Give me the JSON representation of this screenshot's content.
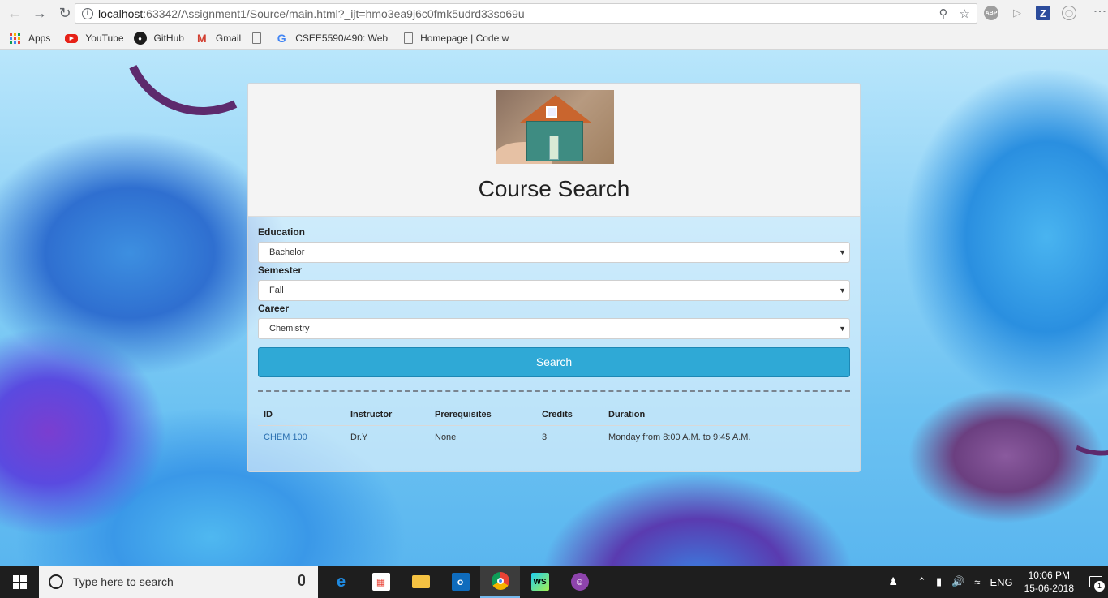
{
  "browser": {
    "url_host": "localhost",
    "url_rest": ":63342/Assignment1/Source/main.html?_ijt=hmo3ea9j6c0fmk5udrd33so69u",
    "extensions": [
      "ABP",
      "Z"
    ]
  },
  "bookmarks": [
    {
      "label": "Apps",
      "icon": "apps-grid-icon"
    },
    {
      "label": "YouTube",
      "icon": "youtube-icon"
    },
    {
      "label": "GitHub",
      "icon": "github-icon"
    },
    {
      "label": "Gmail",
      "icon": "gmail-icon"
    },
    {
      "label": "",
      "icon": "page-icon"
    },
    {
      "label": "CSEE5590/490: Web",
      "icon": "google-icon"
    },
    {
      "label": "Homepage | Code w",
      "icon": "page-icon"
    }
  ],
  "panel": {
    "title": "Course Search",
    "form": {
      "education_label": "Education",
      "education_value": "Bachelor",
      "semester_label": "Semester",
      "semester_value": "Fall",
      "career_label": "Career",
      "career_value": "Chemistry",
      "search_label": "Search"
    },
    "table": {
      "headers": [
        "ID",
        "Instructor",
        "Prerequisites",
        "Credits",
        "Duration"
      ],
      "rows": [
        {
          "id": "CHEM 100",
          "instructor": "Dr.Y",
          "prerequisites": "None",
          "credits": "3",
          "duration": "Monday from 8:00 A.M. to 9:45 A.M."
        }
      ]
    }
  },
  "taskbar": {
    "search_placeholder": "Type here to search",
    "language": "ENG",
    "time": "10:06 PM",
    "date": "15-06-2018",
    "notification_count": "1"
  },
  "colors": {
    "search_button": "#2fa9d6",
    "link": "#2a6fb0",
    "taskbar": "#1e1e1e"
  }
}
